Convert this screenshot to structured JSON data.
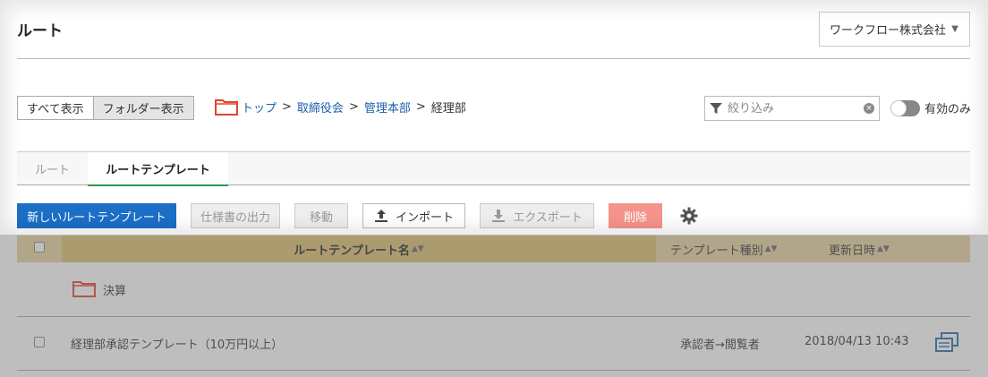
{
  "page": {
    "title": "ルート"
  },
  "company_select": {
    "value": "ワークフロー株式会社",
    "caret": "▼"
  },
  "view_toggle": {
    "all_label": "すべて表示",
    "folder_label": "フォルダー表示"
  },
  "breadcrumb": {
    "items": [
      "トップ",
      "取締役会",
      "管理本部"
    ],
    "separator": ">",
    "current": "経理部"
  },
  "filter": {
    "placeholder": "絞り込み",
    "value": "",
    "clear": "×"
  },
  "active_toggle": {
    "label": "有効のみ"
  },
  "tabs": [
    {
      "label": "ルート"
    },
    {
      "label": "ルートテンプレート"
    }
  ],
  "toolbar": {
    "new_label": "新しいルートテンプレート",
    "spec_label": "仕様書の出力",
    "move_label": "移動",
    "import_label": "インポート",
    "export_label": "エクスポート",
    "delete_label": "削除"
  },
  "table": {
    "headers": {
      "name": "ルートテンプレート名",
      "type": "テンプレート種別",
      "updated": "更新日時"
    },
    "sort_icon": "▲▼",
    "folder_row": {
      "name": "決算"
    },
    "rows": [
      {
        "name": "経理部承認テンプレート（10万円以上）",
        "type": "承認者→閲覧者",
        "updated": "2018/04/13 10:43"
      }
    ]
  },
  "colors": {
    "primary": "#1b6fc7",
    "danger": "#f4948a",
    "header_bg": "#e8d49f",
    "active_tab_underline": "#2e9a4a",
    "folder": "#e0452f",
    "link": "#1a5fa8"
  }
}
